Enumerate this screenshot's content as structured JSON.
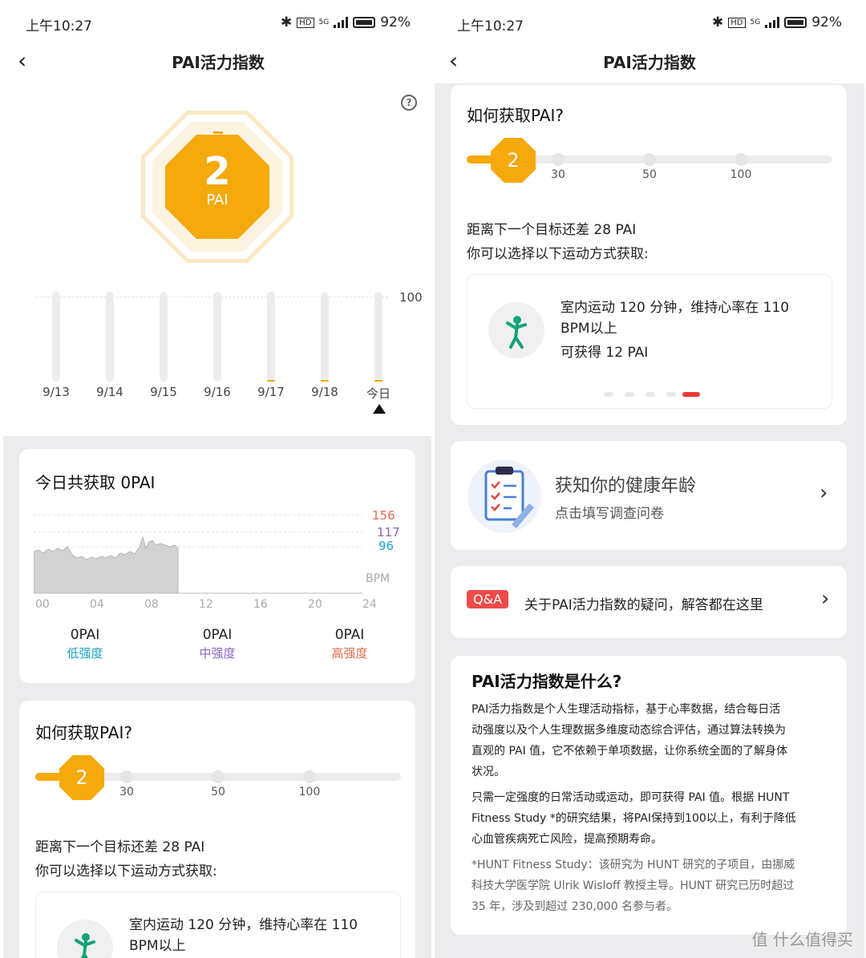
{
  "status": {
    "time": "上午10:27",
    "battery": "92%",
    "network": "5G"
  },
  "left": {
    "nav": {
      "back": "‹",
      "title": "PAI活力指数"
    },
    "hero": {
      "value": "2",
      "unit": "PAI",
      "max_label": "100",
      "days": [
        {
          "label": "9/13",
          "pai": 0
        },
        {
          "label": "9/14",
          "pai": 0
        },
        {
          "label": "9/15",
          "pai": 0
        },
        {
          "label": "9/16",
          "pai": 0
        },
        {
          "label": "9/17",
          "pai": 2
        },
        {
          "label": "9/18",
          "pai": 2
        },
        {
          "label": "今日",
          "pai": 2
        }
      ]
    },
    "today": {
      "title": "今日共获取 0PAI",
      "hr_levels": [
        "156",
        "117",
        "96"
      ],
      "hr_colors": [
        "#e36d4f",
        "#8a64c4",
        "#1aa3c8"
      ],
      "bpm_label": "BPM",
      "axis": [
        "00",
        "04",
        "08",
        "12",
        "16",
        "20",
        "24"
      ],
      "cols": [
        {
          "value": "0PAI",
          "label": "低强度",
          "color": "#1aa3c8"
        },
        {
          "value": "0PAI",
          "label": "中强度",
          "color": "#8a64c4"
        },
        {
          "value": "0PAI",
          "label": "高强度",
          "color": "#e36d4f"
        }
      ]
    },
    "how": {
      "title": "如何获取PAI?",
      "current": "2",
      "milestones": [
        "30",
        "50",
        "100"
      ],
      "line1": "距离下一个目标还差 28 PAI",
      "line2": "你可以选择以下运动方式获取:",
      "tip": {
        "line1": "室内运动 120 分钟，维持心率在 110",
        "line2": "BPM以上"
      }
    }
  },
  "right": {
    "nav": {
      "back": "‹",
      "title": "PAI活力指数"
    },
    "how": {
      "title": "如何获取PAI?",
      "current": "2",
      "milestones": [
        "30",
        "50",
        "100"
      ],
      "line1": "距离下一个目标还差 28 PAI",
      "line2": "你可以选择以下运动方式获取:",
      "tip": {
        "line1": "室内运动 120 分钟，维持心率在 110",
        "line2": "BPM以上",
        "line3": "可获得 12 PAI"
      },
      "pager_active": 5
    },
    "health_age": {
      "title": "获知你的健康年龄",
      "subtitle": "点击填写调查问卷"
    },
    "qa": {
      "badge": "Q&A",
      "text": "关于PAI活力指数的疑问，解答都在这里"
    },
    "what": {
      "title": "PAI活力指数是什么?",
      "p1_lines": [
        "PAI活力指数是个人生理活动指标，基于心率数据，结合每日活",
        "动强度以及个人生理数据多维度动态综合评估，通过算法转换为",
        "直观的 PAI 值，它不依赖于单项数据，让你系统全面的了解身体",
        "状况。"
      ],
      "p2_lines": [
        "只需一定强度的日常活动或运动，即可获得 PAI 值。根据 HUNT",
        "Fitness Study *的研究结果，将PAI保持到100以上，有利于降低",
        "心血管疾病死亡风险，提高预期寿命。"
      ],
      "p3_lines": [
        "*HUNT Fitness Study：该研究为 HUNT 研究的子项目，由挪威",
        "科技大学医学院 Ulrik Wisloff 教授主导。HUNT 研究已历时超过",
        "35 年，涉及到超过 230,000 名参与者。"
      ]
    },
    "watermark": "值 什么值得买"
  },
  "colors": {
    "accent": "#f5a90a",
    "qa_red": "#ef4b4b",
    "pager_active": "#ec3b33"
  }
}
